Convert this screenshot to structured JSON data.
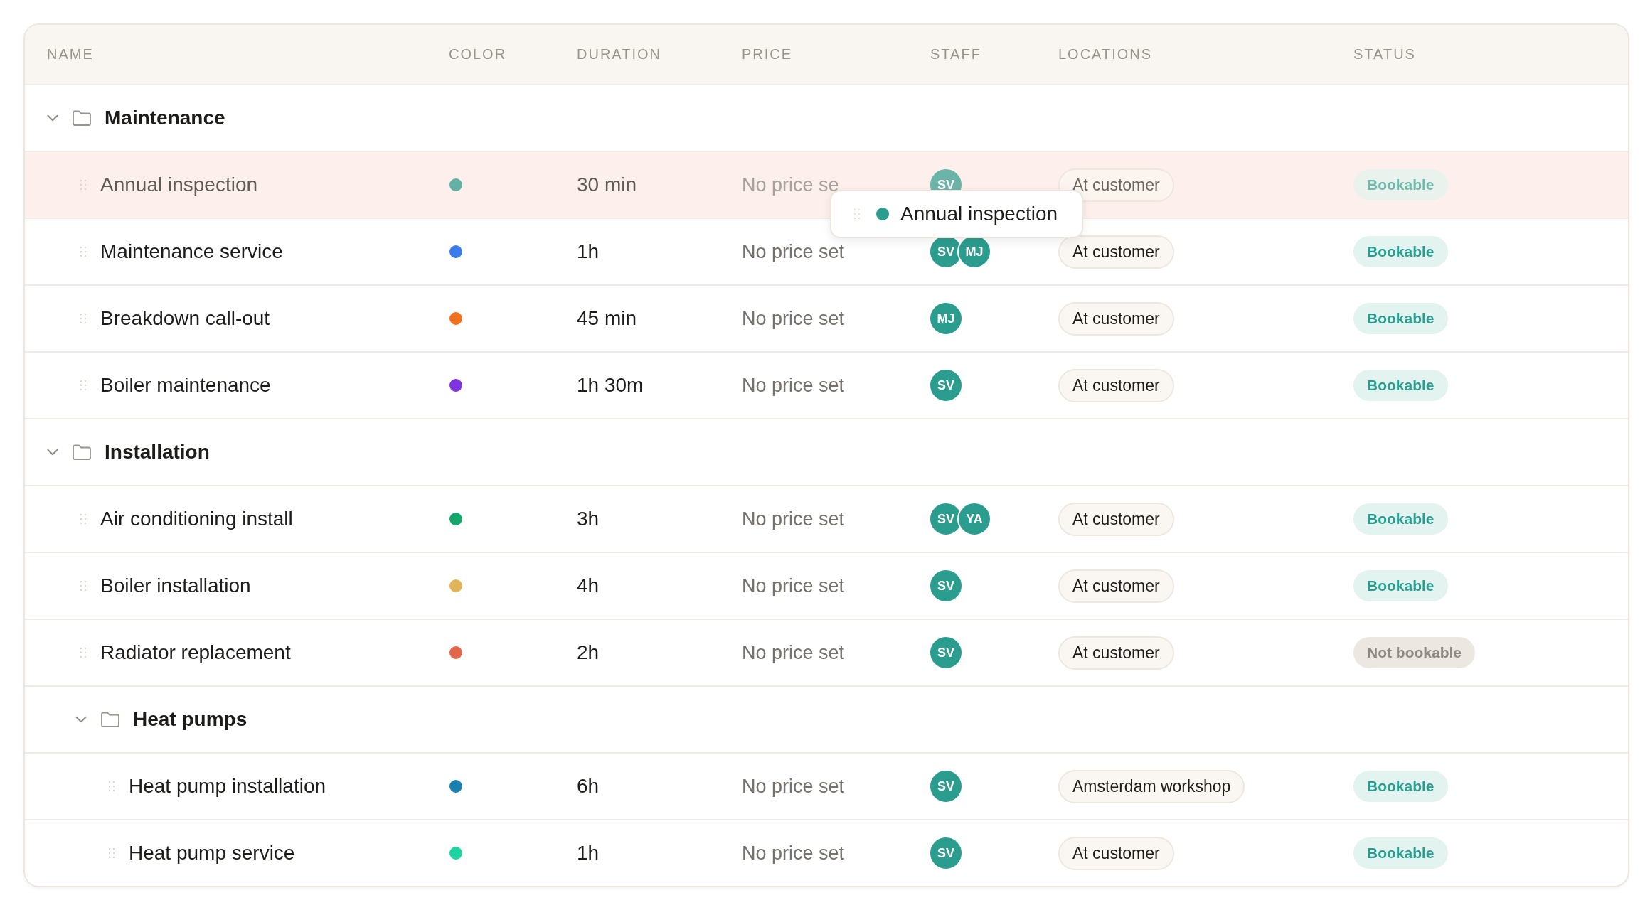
{
  "columns": [
    "NAME",
    "COLOR",
    "DURATION",
    "PRICE",
    "STAFF",
    "LOCATIONS",
    "STATUS"
  ],
  "groups": [
    {
      "name": "Maintenance",
      "expanded": true,
      "children": [
        {
          "kind": "item",
          "name": "Annual inspection",
          "color": "#62b2a4",
          "duration": "30 min",
          "price": "No price se",
          "staff": [
            "SV"
          ],
          "location": "At customer",
          "status": "Bookable",
          "bookable": true,
          "dragging": true
        },
        {
          "kind": "item",
          "name": "Maintenance service",
          "color": "#3b7ded",
          "duration": "1h",
          "price": "No price set",
          "staff": [
            "SV",
            "MJ"
          ],
          "location": "At customer",
          "status": "Bookable",
          "bookable": true,
          "dragging": false
        },
        {
          "kind": "item",
          "name": "Breakdown call-out",
          "color": "#f07020",
          "duration": "45 min",
          "price": "No price set",
          "staff": [
            "MJ"
          ],
          "location": "At customer",
          "status": "Bookable",
          "bookable": true,
          "dragging": false
        },
        {
          "kind": "item",
          "name": "Boiler maintenance",
          "color": "#7e35e0",
          "duration": "1h 30m",
          "price": "No price set",
          "staff": [
            "SV"
          ],
          "location": "At customer",
          "status": "Bookable",
          "bookable": true,
          "dragging": false
        }
      ]
    },
    {
      "name": "Installation",
      "expanded": true,
      "children": [
        {
          "kind": "item",
          "name": "Air conditioning install",
          "color": "#13a86b",
          "duration": "3h",
          "price": "No price set",
          "staff": [
            "SV",
            "YA"
          ],
          "location": "At customer",
          "status": "Bookable",
          "bookable": true,
          "dragging": false
        },
        {
          "kind": "item",
          "name": "Boiler installation",
          "color": "#e3b35a",
          "duration": "4h",
          "price": "No price set",
          "staff": [
            "SV"
          ],
          "location": "At customer",
          "status": "Bookable",
          "bookable": true,
          "dragging": false
        },
        {
          "kind": "item",
          "name": "Radiator replacement",
          "color": "#e2664a",
          "duration": "2h",
          "price": "No price set",
          "staff": [
            "SV"
          ],
          "location": "At customer",
          "status": "Not bookable",
          "bookable": false,
          "dragging": false
        },
        {
          "kind": "group",
          "name": "Heat pumps",
          "expanded": true,
          "children": [
            {
              "kind": "item",
              "name": "Heat pump installation",
              "color": "#1a80b0",
              "duration": "6h",
              "price": "No price set",
              "staff": [
                "SV"
              ],
              "location": "Amsterdam workshop",
              "status": "Bookable",
              "bookable": true,
              "dragging": false
            },
            {
              "kind": "item",
              "name": "Heat pump service",
              "color": "#1ed4a0",
              "duration": "1h",
              "price": "No price set",
              "staff": [
                "SV"
              ],
              "location": "At customer",
              "status": "Bookable",
              "bookable": true,
              "dragging": false
            }
          ]
        }
      ]
    }
  ],
  "drag_preview": {
    "label": "Annual inspection",
    "color": "#2a9d8f"
  }
}
